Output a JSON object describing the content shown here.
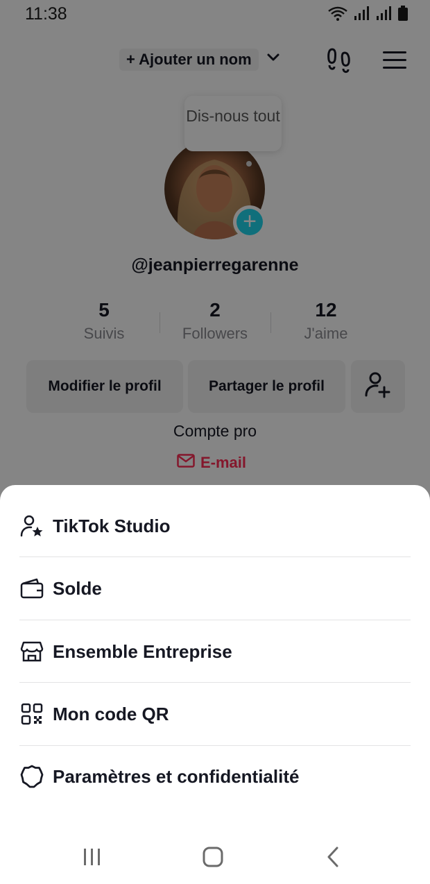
{
  "status_bar": {
    "time": "11:38"
  },
  "header": {
    "add_name_label": "+ Ajouter un nom"
  },
  "tooltip": {
    "text": "Dis-nous tout"
  },
  "profile": {
    "username": "@jeanpierregarenne",
    "stats": [
      {
        "value": "5",
        "label": "Suivis"
      },
      {
        "value": "2",
        "label": "Followers"
      },
      {
        "value": "12",
        "label": "J'aime"
      }
    ],
    "edit_profile_label": "Modifier le profil",
    "share_profile_label": "Partager le profil",
    "account_type": "Compte pro",
    "email_label": "E-mail"
  },
  "menu": {
    "items": [
      {
        "label": "TikTok Studio",
        "icon": "person-star-icon"
      },
      {
        "label": "Solde",
        "icon": "wallet-icon"
      },
      {
        "label": "Ensemble Entreprise",
        "icon": "store-icon"
      },
      {
        "label": "Mon code QR",
        "icon": "qr-code-icon"
      },
      {
        "label": "Paramètres et confidentialité",
        "icon": "gear-icon"
      }
    ]
  },
  "colors": {
    "accent_red": "#fe2c55",
    "accent_cyan": "#20d5ec",
    "text_primary": "#161823",
    "text_secondary": "#8a8b91"
  }
}
